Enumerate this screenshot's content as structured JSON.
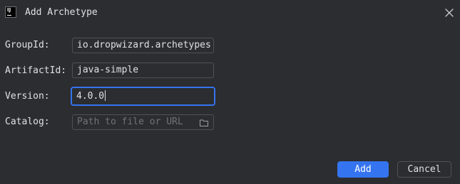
{
  "dialog": {
    "title": "Add Archetype",
    "app_icon": "intellij-idea-icon",
    "close_icon": "close-icon"
  },
  "form": {
    "group_id": {
      "label": "GroupId:",
      "value": "io.dropwizard.archetypes"
    },
    "artifact_id": {
      "label": "ArtifactId:",
      "value": "java-simple"
    },
    "version": {
      "label": "Version:",
      "value": "4.0.0"
    },
    "catalog": {
      "label": "Catalog:",
      "value": "",
      "placeholder": "Path to file or URL",
      "browse_icon": "folder-icon"
    }
  },
  "buttons": {
    "add_label": "Add",
    "cancel_label": "Cancel"
  },
  "colors": {
    "background": "#2b2d30",
    "accent": "#3574f0",
    "text": "#dfe1e5",
    "placeholder": "#6f737a",
    "border": "#4e5157"
  }
}
